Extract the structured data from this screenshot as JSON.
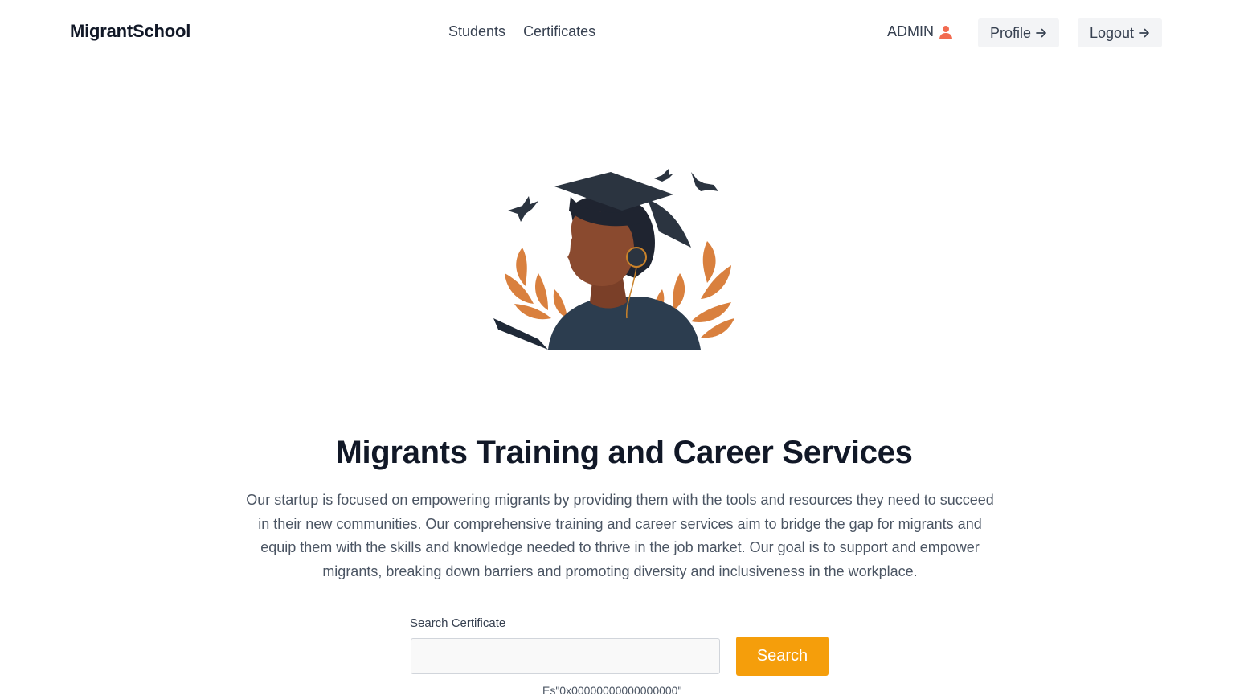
{
  "navbar": {
    "brand": "MigrantSchool",
    "links": [
      {
        "label": "Students"
      },
      {
        "label": "Certificates"
      }
    ],
    "user_label": "ADMIN",
    "user_icon": "user-icon",
    "profile_label": "Profile",
    "logout_label": "Logout",
    "arrow_icon": "arrow-right-icon"
  },
  "hero": {
    "title": "Migrants Training and Career Services",
    "description": "Our startup is focused on empowering migrants by providing them with the tools and resources they need to succeed in their new communities. Our comprehensive training and career services aim to bridge the gap for migrants and equip them with the skills and knowledge needed to thrive in the job market. Our goal is to support and empower migrants, breaking down barriers and promoting diversity and inclusiveness in the workplace."
  },
  "search": {
    "label": "Search Certificate",
    "value": "",
    "placeholder": "",
    "button_label": "Search",
    "hint": "Es\"0x00000000000000000\""
  },
  "colors": {
    "accent": "#f59e0b",
    "user_icon": "#f26b50",
    "button_bg": "#f3f4f6",
    "leaf": "#d9803e",
    "cap": "#1f2937"
  }
}
